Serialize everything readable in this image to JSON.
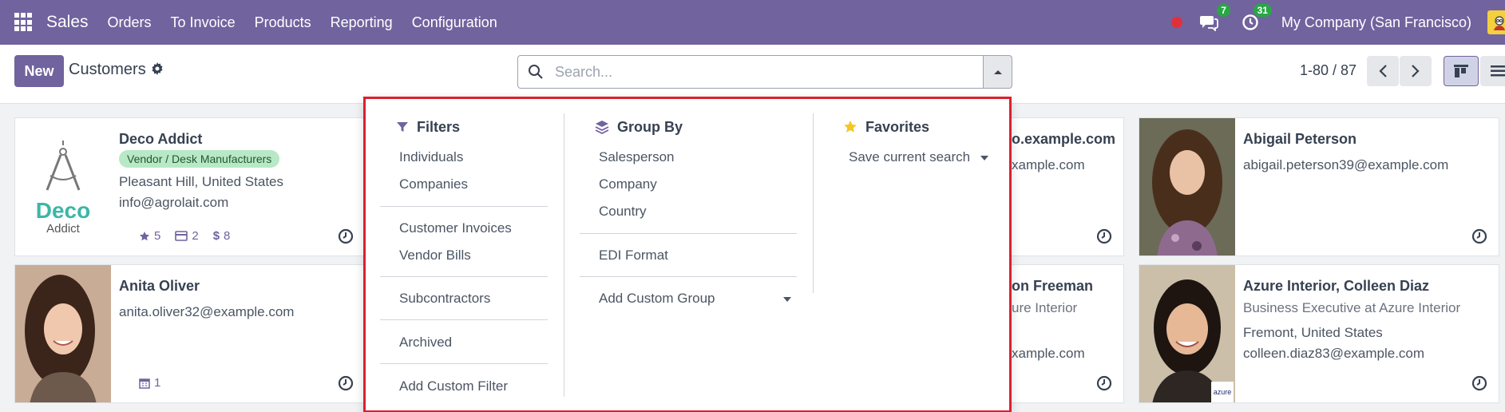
{
  "navbar": {
    "app_name": "Sales",
    "menu": [
      "Orders",
      "To Invoice",
      "Products",
      "Reporting",
      "Configuration"
    ],
    "messages_count": "7",
    "activities_count": "31",
    "company": "My Company (San Francisco)"
  },
  "control": {
    "new_label": "New",
    "title": "Customers",
    "search_placeholder": "Search...",
    "pager": "1-80 / 87"
  },
  "cards": {
    "deco": {
      "name": "Deco Addict",
      "tag": "Vendor / Desk Manufacturers",
      "location": "Pleasant Hill, United States",
      "email": "info@agrolait.com",
      "logo_line1": "Deco",
      "logo_line2": "Addict",
      "stat_stars": "5",
      "stat_cards": "2",
      "stat_money": "8"
    },
    "partial_top": {
      "name_fragment": "o.example.com",
      "email_fragment": "xample.com"
    },
    "abigail": {
      "name": "Abigail Peterson",
      "email": "abigail.peterson39@example.com"
    },
    "anita": {
      "name": "Anita Oliver",
      "email": "anita.oliver32@example.com",
      "stat_cal": "1"
    },
    "partial_bottom": {
      "name_fragment": "on Freeman",
      "company_fragment": "ure Interior",
      "email_fragment": "xample.com"
    },
    "azure": {
      "name": "Azure Interior, Colleen Diaz",
      "job": "Business Executive at Azure Interior",
      "location": "Fremont, United States",
      "email": "colleen.diaz83@example.com",
      "logo_text": "azure"
    }
  },
  "dropdown": {
    "filters": {
      "title": "Filters",
      "items": [
        "Individuals",
        "Companies",
        "Customer Invoices",
        "Vendor Bills",
        "Subcontractors",
        "Archived",
        "Add Custom Filter"
      ]
    },
    "group_by": {
      "title": "Group By",
      "items": [
        "Salesperson",
        "Company",
        "Country",
        "EDI Format",
        "Add Custom Group"
      ]
    },
    "favorites": {
      "title": "Favorites",
      "items": [
        "Save current search"
      ]
    }
  },
  "colors": {
    "brand": "#71639e",
    "highlight_border": "#dc1f2f",
    "badge_green": "#28a745",
    "tag_green": "#b9e8c6",
    "favorites_star": "#f3c623"
  },
  "icons": [
    "apps-grid-icon",
    "chat-icon",
    "clock-activity-icon",
    "gear-icon",
    "search-icon",
    "caret-up-icon",
    "chevron-left-icon",
    "chevron-right-icon",
    "kanban-view-icon",
    "list-view-icon",
    "filter-icon",
    "layers-icon",
    "star-icon",
    "clock-icon",
    "star-stat-icon",
    "card-stat-icon",
    "dollar-icon",
    "calendar-icon"
  ]
}
